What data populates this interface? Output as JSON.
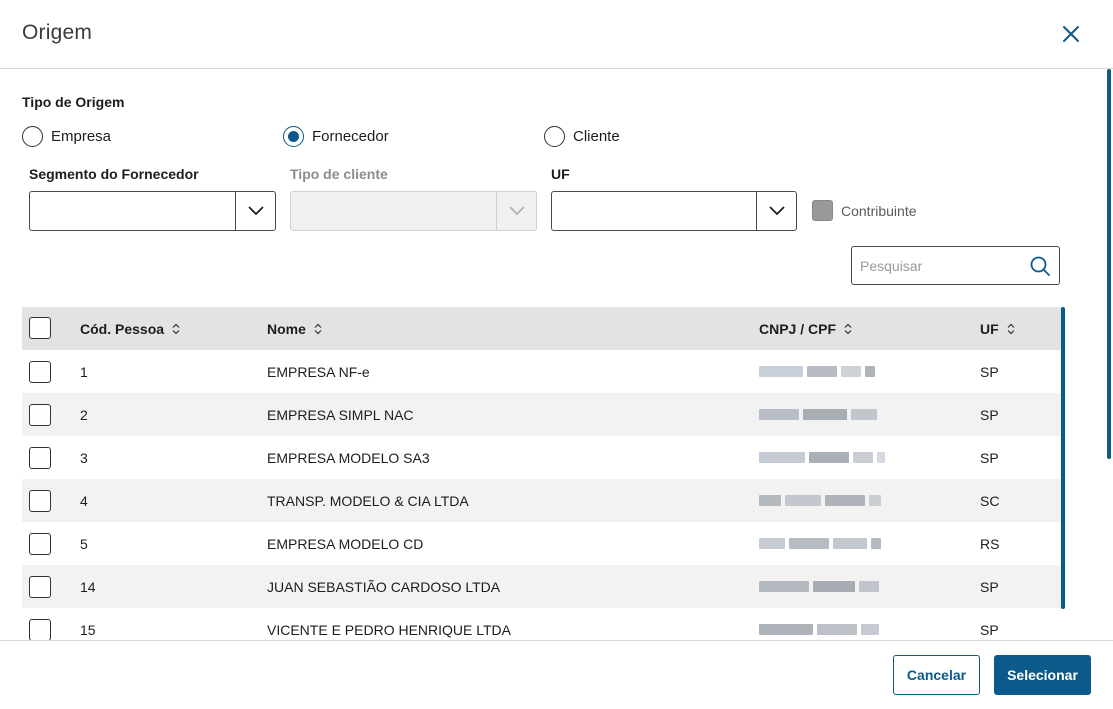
{
  "dialog": {
    "title": "Origem"
  },
  "origin_type": {
    "label": "Tipo de Origem",
    "options": [
      {
        "label": "Empresa",
        "checked": false
      },
      {
        "label": "Fornecedor",
        "checked": true
      },
      {
        "label": "Cliente",
        "checked": false
      }
    ]
  },
  "filters": {
    "segment_label": "Segmento do Fornecedor",
    "client_type_label": "Tipo de cliente",
    "uf_label": "UF",
    "contributor_label": "Contribuinte"
  },
  "search": {
    "placeholder": "Pesquisar"
  },
  "table": {
    "columns": [
      "Cód. Pessoa",
      "Nome",
      "CNPJ / CPF",
      "UF"
    ],
    "rows": [
      {
        "code": "1",
        "name": "EMPRESA NF-e",
        "uf": "SP"
      },
      {
        "code": "2",
        "name": "EMPRESA SIMPL NAC",
        "uf": "SP"
      },
      {
        "code": "3",
        "name": "EMPRESA MODELO SA3",
        "uf": "SP"
      },
      {
        "code": "4",
        "name": "TRANSP. MODELO & CIA LTDA",
        "uf": "SC"
      },
      {
        "code": "5",
        "name": "EMPRESA MODELO CD",
        "uf": "RS"
      },
      {
        "code": "14",
        "name": "JUAN SEBASTIÃO CARDOSO LTDA",
        "uf": "SP"
      },
      {
        "code": "15",
        "name": "VICENTE E PEDRO HENRIQUE LTDA",
        "uf": "SP"
      }
    ]
  },
  "footer": {
    "cancel_label": "Cancelar",
    "select_label": "Selecionar"
  },
  "colors": {
    "accent": "#0c5a8a",
    "header_row": "#e3e3e3",
    "alt_row": "#f2f2f2"
  }
}
